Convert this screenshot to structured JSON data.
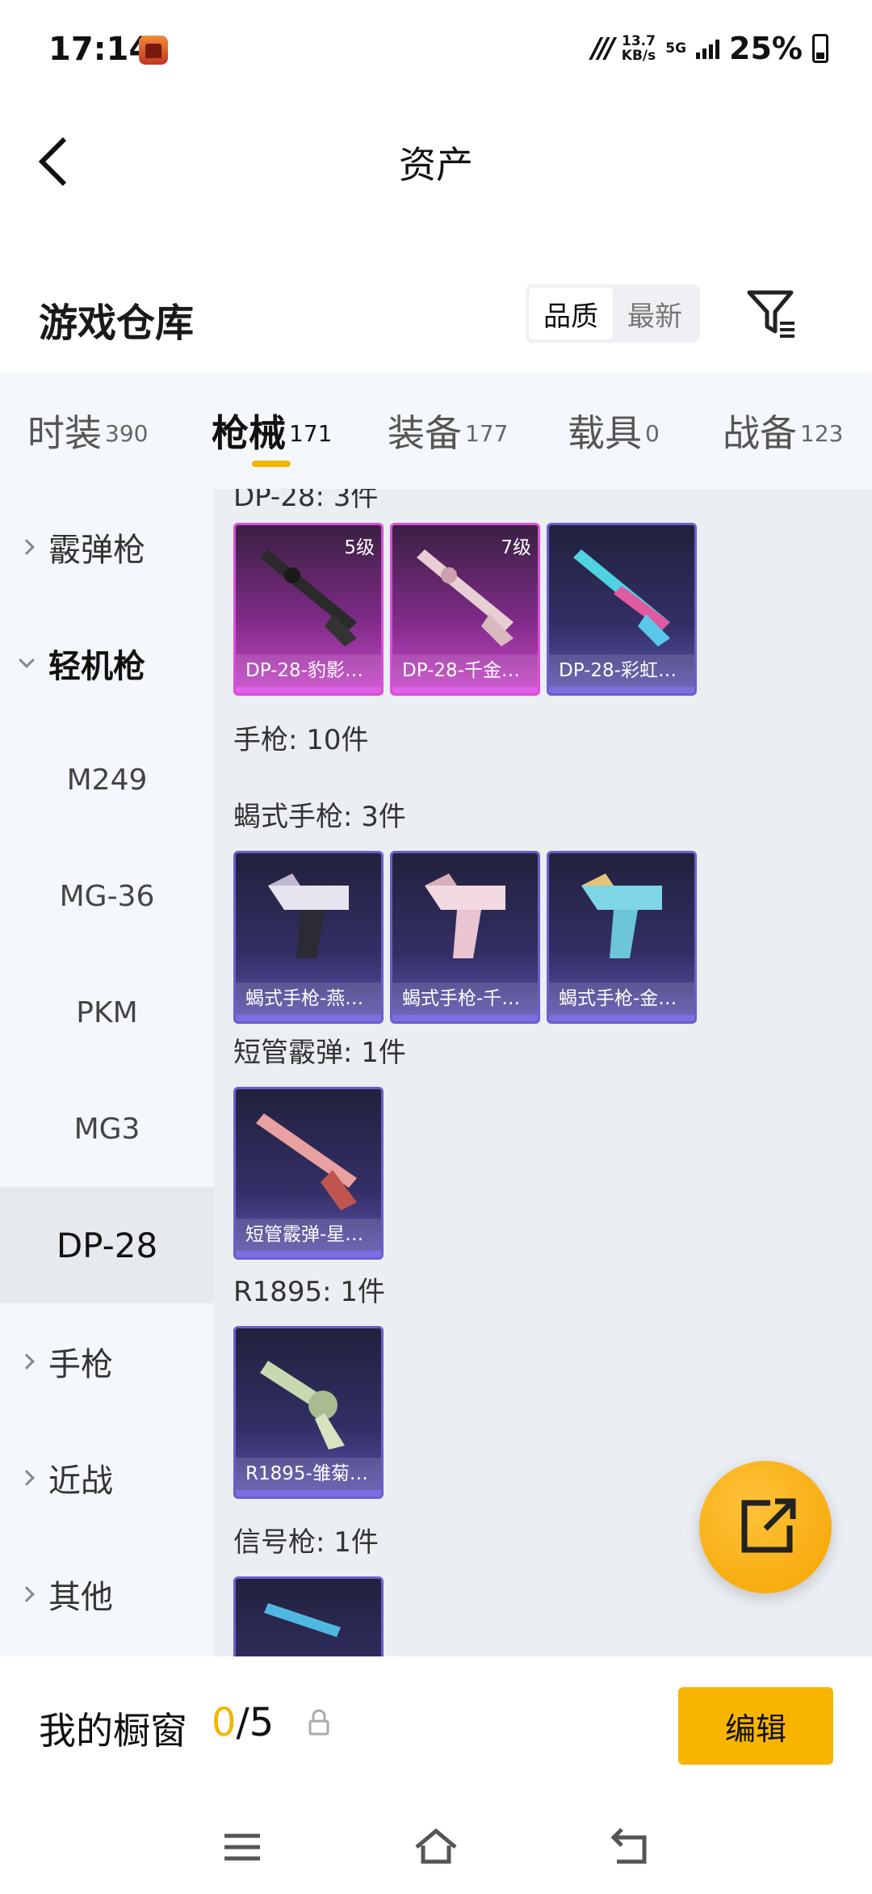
{
  "status_bar": {
    "time": "17:14",
    "net_speed_value": "13.7",
    "net_speed_unit": "KB/s",
    "network": "5G",
    "battery": "25%"
  },
  "header": {
    "title": "资产"
  },
  "warehouse": {
    "title": "游戏仓库",
    "sort_options": [
      "品质",
      "最新"
    ],
    "active_sort": "品质"
  },
  "tabs": [
    {
      "label": "时装",
      "count": "390"
    },
    {
      "label": "枪械",
      "count": "171"
    },
    {
      "label": "装备",
      "count": "177"
    },
    {
      "label": "载具",
      "count": "0"
    },
    {
      "label": "战备",
      "count": "123"
    }
  ],
  "active_tab": "枪械",
  "sidebar": {
    "items": [
      {
        "label": "霰弹枪"
      },
      {
        "label": "轻机枪"
      },
      {
        "label": "M249"
      },
      {
        "label": "MG-36"
      },
      {
        "label": "PKM"
      },
      {
        "label": "MG3"
      },
      {
        "label": "DP-28"
      },
      {
        "label": "手枪"
      },
      {
        "label": "近战"
      },
      {
        "label": "其他"
      }
    ],
    "selected": "DP-28"
  },
  "content": {
    "groups": [
      {
        "title": "DP-28: 3件",
        "items": [
          {
            "name": "DP-28-豹影…",
            "level": "5级",
            "quality": "pink"
          },
          {
            "name": "DP-28-千金…",
            "level": "7级",
            "quality": "pink"
          },
          {
            "name": "DP-28-彩虹…",
            "level": "",
            "quality": "purple"
          }
        ]
      },
      {
        "title": "手枪: 10件",
        "items": []
      },
      {
        "title": "蝎式手枪: 3件",
        "items": [
          {
            "name": "蝎式手枪-燕…",
            "level": "",
            "quality": "purple"
          },
          {
            "name": "蝎式手枪-千…",
            "level": "",
            "quality": "purple"
          },
          {
            "name": "蝎式手枪-金…",
            "level": "",
            "quality": "purple"
          }
        ]
      },
      {
        "title": "短管霰弹: 1件",
        "items": [
          {
            "name": "短管霰弹-星…",
            "level": "",
            "quality": "purple"
          }
        ]
      },
      {
        "title": "R1895: 1件",
        "items": [
          {
            "name": "R1895-雏菊…",
            "level": "",
            "quality": "purple"
          }
        ]
      },
      {
        "title": "信号枪: 1件",
        "items": []
      }
    ]
  },
  "showcase": {
    "title": "我的橱窗",
    "current": "0",
    "separator": "/",
    "max": "5",
    "edit_label": "编辑"
  },
  "colors": {
    "accent": "#f5b400",
    "quality_pink": "#d94fd9",
    "quality_purple": "#6a5fcc"
  }
}
